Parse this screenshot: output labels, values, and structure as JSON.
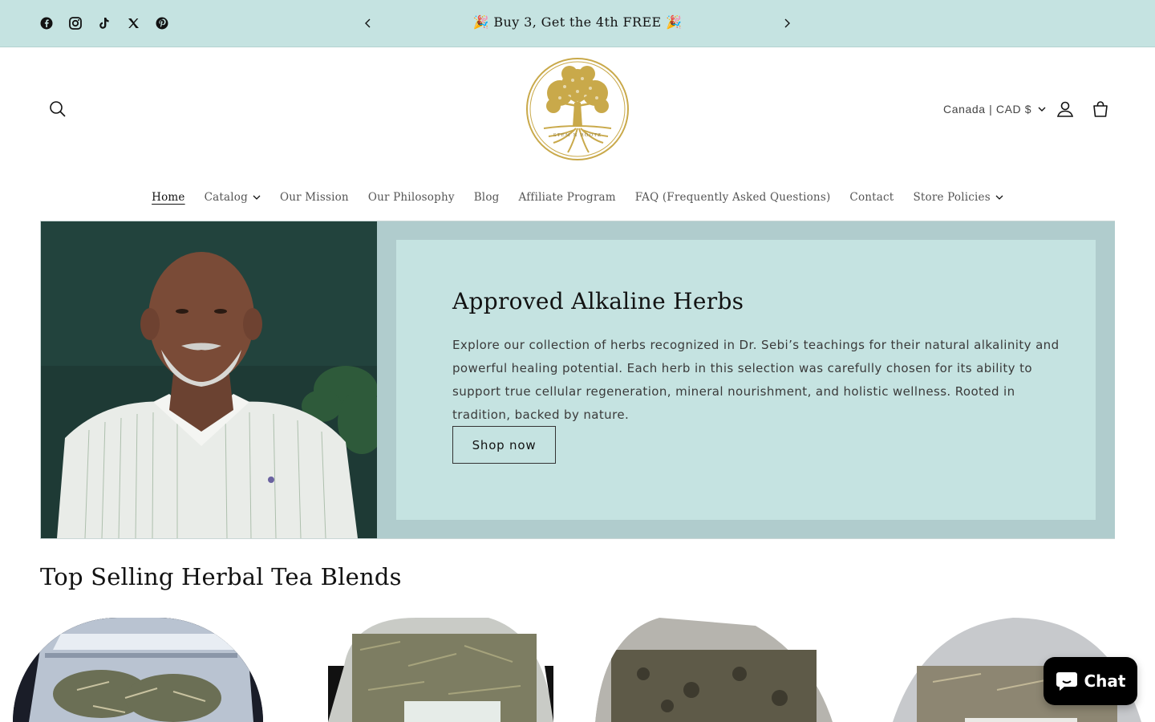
{
  "announcement": {
    "text": "🎉 Buy 3, Get the 4th FREE 🎉",
    "social_icons": [
      "facebook-icon",
      "instagram-icon",
      "tiktok-icon",
      "x-icon",
      "pinterest-icon"
    ]
  },
  "header": {
    "logo_text": "STEM N ROOTZ",
    "country_label": "Canada | CAD $"
  },
  "nav": {
    "items": [
      {
        "label": "Home"
      },
      {
        "label": "Catalog"
      },
      {
        "label": "Our Mission"
      },
      {
        "label": "Our Philosophy"
      },
      {
        "label": "Blog"
      },
      {
        "label": "Affiliate Program"
      },
      {
        "label": "FAQ (Frequently Asked Questions)"
      },
      {
        "label": "Contact"
      },
      {
        "label": "Store Policies"
      }
    ]
  },
  "hero": {
    "title": "Approved Alkaline Herbs",
    "body": "Explore our collection of herbs recognized in Dr. Sebi’s teachings for their natural alkalinity and powerful healing potential. Each herb in this selection was carefully chosen for its ability to support true cellular regeneration, mineral nourishment, and holistic wellness. Rooted in tradition, backed by nature.",
    "button_label": "Shop now"
  },
  "section": {
    "title": "Top Selling Herbal Tea Blends"
  },
  "chat": {
    "label": "Chat"
  },
  "colors": {
    "announcement_bg": "#c5e3e1",
    "hero_panel_outer": "#b0cccd",
    "hero_panel_inner": "#c5e3e1",
    "logo_gold": "#c9a94a"
  }
}
